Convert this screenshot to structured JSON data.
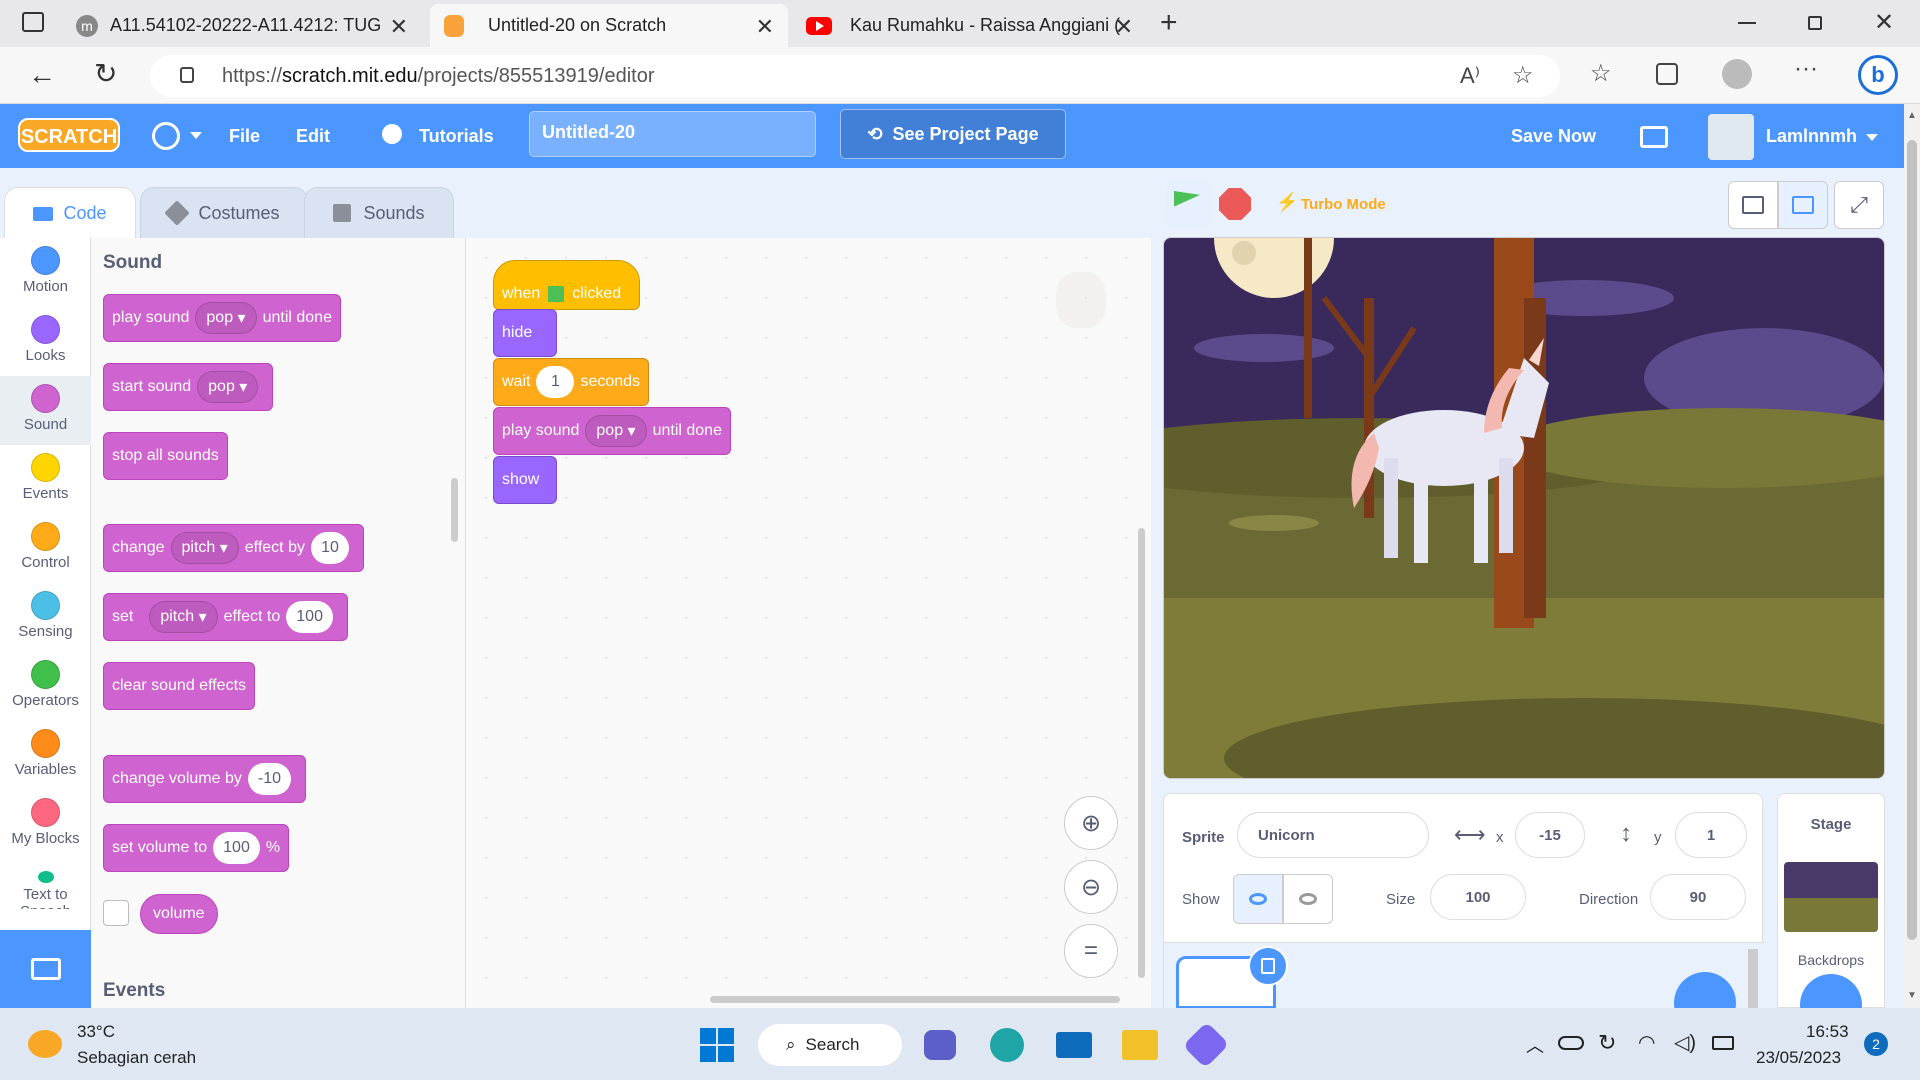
{
  "browser": {
    "tabs": [
      {
        "title": "A11.54102-20222-A11.4212: TUG",
        "icon": "moodle-icon"
      },
      {
        "title": "Untitled-20 on Scratch",
        "icon": "scratch-icon"
      },
      {
        "title": "Kau Rumahku - Raissa Anggiani (",
        "icon": "youtube-icon"
      }
    ],
    "url_prefix": "https://",
    "url_domain": "scratch.mit.edu",
    "url_path": "/projects/855513919/editor"
  },
  "menubar": {
    "logo": "SCRATCH",
    "file": "File",
    "edit": "Edit",
    "tutorials": "Tutorials",
    "project_title": "Untitled-20",
    "see_project": "See Project Page",
    "save_now": "Save Now",
    "username": "Lamlnnmh"
  },
  "editor_tabs": {
    "code": "Code",
    "costumes": "Costumes",
    "sounds": "Sounds"
  },
  "categories": [
    {
      "label": "Motion",
      "color": "#4c97ff"
    },
    {
      "label": "Looks",
      "color": "#9966ff"
    },
    {
      "label": "Sound",
      "color": "#cf63cf"
    },
    {
      "label": "Events",
      "color": "#ffd500"
    },
    {
      "label": "Control",
      "color": "#ffab19"
    },
    {
      "label": "Sensing",
      "color": "#4cbfe6"
    },
    {
      "label": "Operators",
      "color": "#40bf4a"
    },
    {
      "label": "Variables",
      "color": "#ff8c1a"
    },
    {
      "label": "My Blocks",
      "color": "#ff6680"
    },
    {
      "label": "Text to Speech",
      "color": "#0fbd8c"
    }
  ],
  "palette": {
    "section_sound": "Sound",
    "section_events": "Events",
    "play_sound": {
      "a": "play sound",
      "dd": "pop",
      "b": "until done"
    },
    "start_sound": {
      "a": "start sound",
      "dd": "pop"
    },
    "stop_all": "stop all sounds",
    "change_effect": {
      "a": "change",
      "dd": "pitch",
      "b": "effect by",
      "v": "10"
    },
    "set_effect": {
      "a": "set",
      "dd": "pitch",
      "b": "effect to",
      "v": "100"
    },
    "clear_effects": "clear sound effects",
    "change_volume": {
      "a": "change volume by",
      "v": "-10"
    },
    "set_volume": {
      "a": "set volume to",
      "v": "100",
      "b": "%"
    },
    "volume": "volume"
  },
  "script": {
    "when": "when",
    "clicked": "clicked",
    "hide": "hide",
    "wait": {
      "a": "wait",
      "v": "1",
      "b": "seconds"
    },
    "play_sound": {
      "a": "play sound",
      "dd": "pop",
      "b": "until done"
    },
    "show": "show"
  },
  "stage_controls": {
    "turbo": "Turbo Mode"
  },
  "sprite_info": {
    "sprite_label": "Sprite",
    "sprite_name": "Unicorn",
    "x_label": "x",
    "x": "-15",
    "y_label": "y",
    "y": "1",
    "show_label": "Show",
    "size_label": "Size",
    "size": "100",
    "direction_label": "Direction",
    "direction": "90"
  },
  "stage_pane": {
    "title": "Stage",
    "backdrops": "Backdrops"
  },
  "taskbar": {
    "temp": "33°C",
    "weather": "Sebagian cerah",
    "search": "Search",
    "time": "16:53",
    "date": "23/05/2023",
    "notifications": "2"
  }
}
